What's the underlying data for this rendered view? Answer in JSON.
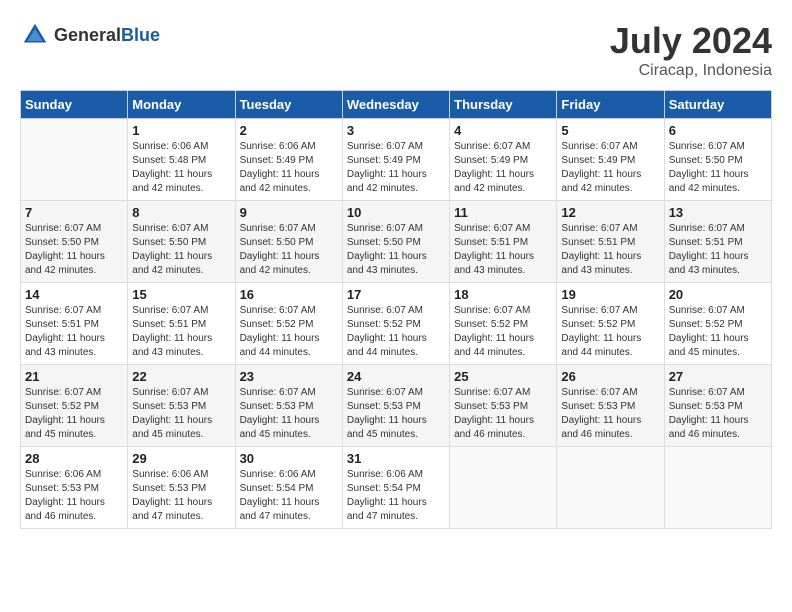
{
  "header": {
    "logo_general": "General",
    "logo_blue": "Blue",
    "month_year": "July 2024",
    "location": "Ciracap, Indonesia"
  },
  "days_of_week": [
    "Sunday",
    "Monday",
    "Tuesday",
    "Wednesday",
    "Thursday",
    "Friday",
    "Saturday"
  ],
  "weeks": [
    [
      {
        "day": "",
        "info": ""
      },
      {
        "day": "1",
        "info": "Sunrise: 6:06 AM\nSunset: 5:48 PM\nDaylight: 11 hours\nand 42 minutes."
      },
      {
        "day": "2",
        "info": "Sunrise: 6:06 AM\nSunset: 5:49 PM\nDaylight: 11 hours\nand 42 minutes."
      },
      {
        "day": "3",
        "info": "Sunrise: 6:07 AM\nSunset: 5:49 PM\nDaylight: 11 hours\nand 42 minutes."
      },
      {
        "day": "4",
        "info": "Sunrise: 6:07 AM\nSunset: 5:49 PM\nDaylight: 11 hours\nand 42 minutes."
      },
      {
        "day": "5",
        "info": "Sunrise: 6:07 AM\nSunset: 5:49 PM\nDaylight: 11 hours\nand 42 minutes."
      },
      {
        "day": "6",
        "info": "Sunrise: 6:07 AM\nSunset: 5:50 PM\nDaylight: 11 hours\nand 42 minutes."
      }
    ],
    [
      {
        "day": "7",
        "info": "Sunrise: 6:07 AM\nSunset: 5:50 PM\nDaylight: 11 hours\nand 42 minutes."
      },
      {
        "day": "8",
        "info": "Sunrise: 6:07 AM\nSunset: 5:50 PM\nDaylight: 11 hours\nand 42 minutes."
      },
      {
        "day": "9",
        "info": "Sunrise: 6:07 AM\nSunset: 5:50 PM\nDaylight: 11 hours\nand 42 minutes."
      },
      {
        "day": "10",
        "info": "Sunrise: 6:07 AM\nSunset: 5:50 PM\nDaylight: 11 hours\nand 43 minutes."
      },
      {
        "day": "11",
        "info": "Sunrise: 6:07 AM\nSunset: 5:51 PM\nDaylight: 11 hours\nand 43 minutes."
      },
      {
        "day": "12",
        "info": "Sunrise: 6:07 AM\nSunset: 5:51 PM\nDaylight: 11 hours\nand 43 minutes."
      },
      {
        "day": "13",
        "info": "Sunrise: 6:07 AM\nSunset: 5:51 PM\nDaylight: 11 hours\nand 43 minutes."
      }
    ],
    [
      {
        "day": "14",
        "info": "Sunrise: 6:07 AM\nSunset: 5:51 PM\nDaylight: 11 hours\nand 43 minutes."
      },
      {
        "day": "15",
        "info": "Sunrise: 6:07 AM\nSunset: 5:51 PM\nDaylight: 11 hours\nand 43 minutes."
      },
      {
        "day": "16",
        "info": "Sunrise: 6:07 AM\nSunset: 5:52 PM\nDaylight: 11 hours\nand 44 minutes."
      },
      {
        "day": "17",
        "info": "Sunrise: 6:07 AM\nSunset: 5:52 PM\nDaylight: 11 hours\nand 44 minutes."
      },
      {
        "day": "18",
        "info": "Sunrise: 6:07 AM\nSunset: 5:52 PM\nDaylight: 11 hours\nand 44 minutes."
      },
      {
        "day": "19",
        "info": "Sunrise: 6:07 AM\nSunset: 5:52 PM\nDaylight: 11 hours\nand 44 minutes."
      },
      {
        "day": "20",
        "info": "Sunrise: 6:07 AM\nSunset: 5:52 PM\nDaylight: 11 hours\nand 45 minutes."
      }
    ],
    [
      {
        "day": "21",
        "info": "Sunrise: 6:07 AM\nSunset: 5:52 PM\nDaylight: 11 hours\nand 45 minutes."
      },
      {
        "day": "22",
        "info": "Sunrise: 6:07 AM\nSunset: 5:53 PM\nDaylight: 11 hours\nand 45 minutes."
      },
      {
        "day": "23",
        "info": "Sunrise: 6:07 AM\nSunset: 5:53 PM\nDaylight: 11 hours\nand 45 minutes."
      },
      {
        "day": "24",
        "info": "Sunrise: 6:07 AM\nSunset: 5:53 PM\nDaylight: 11 hours\nand 45 minutes."
      },
      {
        "day": "25",
        "info": "Sunrise: 6:07 AM\nSunset: 5:53 PM\nDaylight: 11 hours\nand 46 minutes."
      },
      {
        "day": "26",
        "info": "Sunrise: 6:07 AM\nSunset: 5:53 PM\nDaylight: 11 hours\nand 46 minutes."
      },
      {
        "day": "27",
        "info": "Sunrise: 6:07 AM\nSunset: 5:53 PM\nDaylight: 11 hours\nand 46 minutes."
      }
    ],
    [
      {
        "day": "28",
        "info": "Sunrise: 6:06 AM\nSunset: 5:53 PM\nDaylight: 11 hours\nand 46 minutes."
      },
      {
        "day": "29",
        "info": "Sunrise: 6:06 AM\nSunset: 5:53 PM\nDaylight: 11 hours\nand 47 minutes."
      },
      {
        "day": "30",
        "info": "Sunrise: 6:06 AM\nSunset: 5:54 PM\nDaylight: 11 hours\nand 47 minutes."
      },
      {
        "day": "31",
        "info": "Sunrise: 6:06 AM\nSunset: 5:54 PM\nDaylight: 11 hours\nand 47 minutes."
      },
      {
        "day": "",
        "info": ""
      },
      {
        "day": "",
        "info": ""
      },
      {
        "day": "",
        "info": ""
      }
    ]
  ]
}
